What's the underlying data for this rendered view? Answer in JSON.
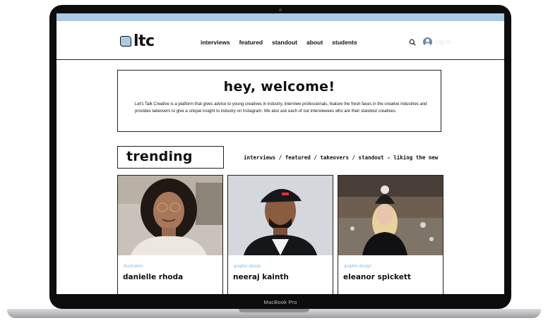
{
  "device": {
    "model_label": "MacBook Pro"
  },
  "site": {
    "logo_text": "ltc",
    "nav": [
      "interviews",
      "featured",
      "standout",
      "about",
      "students"
    ],
    "login_label": "Log In",
    "welcome_title": "hey, welcome!",
    "welcome_text": "Let's Talk Creative is a platform that gives advice to young creatives in industry, interview professionals, feature the fresh faces in the creative industries and provides takeovers to give a unique insight to industry on Instagram. We also ask each of our interviewees who are their standout creatives.",
    "trending_label": "trending",
    "ticker_text": "interviews / featured / takeovers / standout - liking the new site? let",
    "cards": [
      {
        "category": "illustration",
        "name": "danielle rhoda"
      },
      {
        "category": "graphic design",
        "name": "neeraj kainth"
      },
      {
        "category": "graphic design",
        "name": "eleanor spickett"
      }
    ]
  },
  "colors": {
    "accent_blue": "#a9cbe8",
    "category_blue": "#8ab7dc"
  }
}
